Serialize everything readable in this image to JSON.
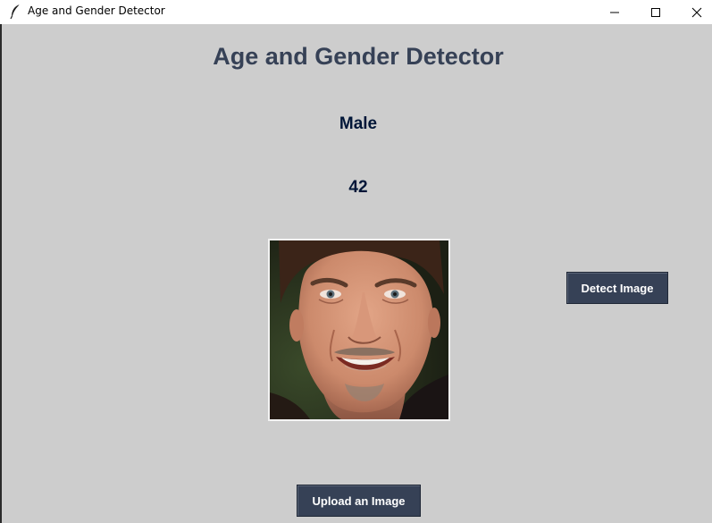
{
  "window": {
    "title": "Age and Gender Detector",
    "icon": "feather-icon",
    "controls": [
      "minimize-icon",
      "maximize-icon",
      "close-icon"
    ]
  },
  "main": {
    "heading": "Age and Gender Detector",
    "gender_result": "Male",
    "age_result": "42",
    "photo_icon": "face-photo",
    "detect_button": "Detect Image",
    "upload_button": "Upload an Image"
  },
  "colors": {
    "background": "#cdcdcd",
    "heading": "#364156",
    "result_text": "#011638",
    "button_bg": "#364156",
    "button_text": "#ffffff"
  }
}
